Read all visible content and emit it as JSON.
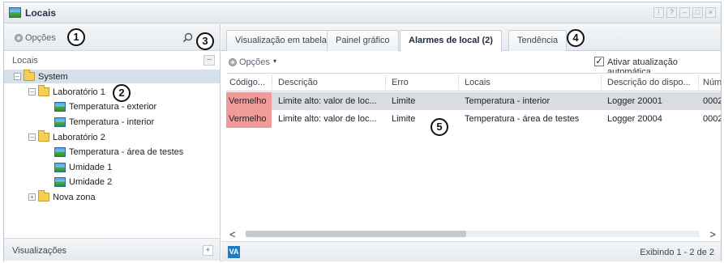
{
  "window": {
    "title": "Locais",
    "controls": [
      "⁞",
      "?",
      "–",
      "□",
      "×"
    ]
  },
  "callouts": [
    "1",
    "2",
    "3",
    "4",
    "5"
  ],
  "left": {
    "options_label": "Opções",
    "locations_header": "Locais",
    "collapse_symbol": "–",
    "tree": [
      {
        "label": "System",
        "type": "folder",
        "expander": "–"
      },
      {
        "label": "Laboratório 1",
        "type": "folder",
        "expander": "–"
      },
      {
        "label": "Temperatura - exterior",
        "type": "sensor"
      },
      {
        "label": "Temperatura - interior",
        "type": "sensor"
      },
      {
        "label": "Laboratório 2",
        "type": "folder",
        "expander": "–"
      },
      {
        "label": "Temperatura - área de testes",
        "type": "sensor"
      },
      {
        "label": "Umidade 1",
        "type": "sensor"
      },
      {
        "label": "Umidade 2",
        "type": "sensor"
      },
      {
        "label": "Nova zona",
        "type": "folder",
        "expander": "+"
      }
    ],
    "views_label": "Visualizações",
    "add_symbol": "+"
  },
  "right": {
    "tabs": [
      {
        "label": "Visualização em tabela"
      },
      {
        "label": "Painel gráfico"
      },
      {
        "label": "Alarmes de local (2)"
      },
      {
        "label": "Tendência"
      }
    ],
    "active_tab": 2,
    "toolbar": {
      "options_label": "Opções",
      "caret": "▾",
      "auto_update_label": "Ativar atualização automática",
      "auto_update_checked": true,
      "check_symbol": "✓"
    },
    "grid": {
      "columns": [
        "Código...",
        "Descrição",
        "Erro",
        "Locais",
        "Descrição do dispo...",
        "Núm"
      ],
      "rows": [
        [
          "Vermelho",
          "Limite alto: valor de loc...",
          "Limite",
          "Temperatura - interior",
          "Logger 20001",
          "0002"
        ],
        [
          "Vermelho",
          "Limite alto: valor de loc...",
          "Limite",
          "Temperatura - área de testes",
          "Logger 20004",
          "0002"
        ]
      ]
    },
    "scroll": {
      "left_arrow": "<",
      "right_arrow": ">"
    },
    "footer": {
      "badge": "VA",
      "paging": "Exibindo 1 - 2 de 2"
    }
  },
  "colors": {
    "alarm_red": "#f19a9a",
    "selected_row": "#d9dde2",
    "tree_selected": "#d6e0ea"
  }
}
